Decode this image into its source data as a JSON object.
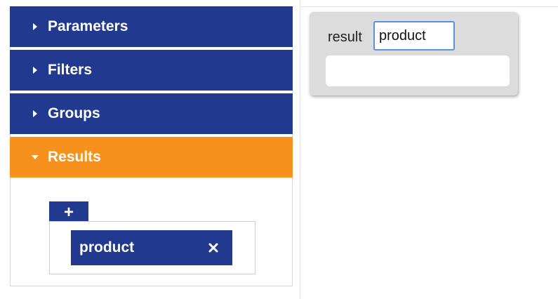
{
  "sidebar": {
    "sections": [
      {
        "label": "Parameters",
        "expanded": false
      },
      {
        "label": "Filters",
        "expanded": false
      },
      {
        "label": "Groups",
        "expanded": false
      },
      {
        "label": "Results",
        "expanded": true
      }
    ],
    "results": {
      "add_label": "+",
      "items": [
        {
          "label": "product",
          "remove_icon": "close-icon"
        }
      ]
    }
  },
  "editor": {
    "field_label": "result",
    "field_value": "product"
  },
  "colors": {
    "primary": "#213a8f",
    "active": "#f7911d",
    "card": "#dcdcdc",
    "focus": "#5b8fe0"
  }
}
